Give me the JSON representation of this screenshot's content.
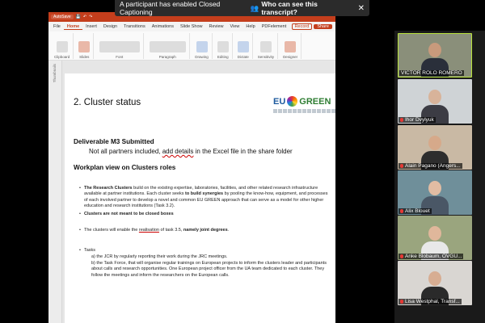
{
  "banner": {
    "message": "A participant has enabled Closed Captioning",
    "who_label": "Who can see this transcript?"
  },
  "ppt": {
    "autosave": "AutoSave",
    "tabs": [
      "File",
      "Home",
      "Insert",
      "Design",
      "Transitions",
      "Animations",
      "Slide Show",
      "Review",
      "View",
      "Help",
      "PDFelement"
    ],
    "active_tab": "Home",
    "record_label": "Record",
    "share_label": "Share",
    "ribbon_groups": [
      "Clipboard",
      "Slides",
      "Font",
      "Paragraph",
      "Drawing",
      "Editing",
      "Dictate",
      "Sensitivity",
      "Designer"
    ],
    "thumbnails_label": "Thumbnails"
  },
  "slide": {
    "title": "2. Cluster status",
    "logo_eu": "EU",
    "logo_green": "GREEN",
    "deliverable": "Deliverable M3 Submitted",
    "note_prefix": "Not all partners included, ",
    "note_underlined": "add details",
    "note_suffix": " in the Excel file in the share folder",
    "workplan": "Workplan view on Clusters roles",
    "b1_bold": "The Research Clusters",
    "b1_text": " build on the existing expertise, laboratories, facilities, and other related research infrastructure available at partner institutions. Each cluster seeks ",
    "b1_bold2": "to build synergies",
    "b1_text2": " by pooling the know-how, equipment, and processes of each involved partner to develop a novel and common EU GREEN approach that can serve as a model for other higher education and research institutions (Task 3.2).",
    "b2": "Clusters are not meant to be closed boxes",
    "b3_pre": "The clusters will enable the ",
    "b3_u": "realisation",
    "b3_mid": " of task 3.5, ",
    "b3_bold": "namely joint degrees",
    "b3_end": ".",
    "b4": "Tasks",
    "s1": "a) the JCR by regularly reporting their work during the JRC meetings.",
    "s2_pre": "b) the Task Force, that will ",
    "s2_u": "organise",
    "s2_text": " regular trainings on European projects to inform the clusters leader and participants about calls and research opportunities. One European project officer from the UA team dedicated to each cluster. They follow the meetings and inform the researchers on the European calls."
  },
  "participants": [
    {
      "name": "VICTOR ROLO ROMERO",
      "muted": false,
      "bg": "#8a8f7a",
      "skin": "#c89a7c",
      "shirt": "#2a2f3a"
    },
    {
      "name": "Ihor Dvylyuk",
      "muted": true,
      "bg": "#cfd3d6",
      "skin": "#d8b39a",
      "shirt": "#3c3c44"
    },
    {
      "name": "Alain Pagano (Angers...",
      "muted": true,
      "bg": "#c9b9a4",
      "skin": "#d6a98a",
      "shirt": "#2d2d2d"
    },
    {
      "name": "Alix Blouet",
      "muted": true,
      "bg": "#6f8f9a",
      "skin": "#e1bca3",
      "shirt": "#4a5766"
    },
    {
      "name": "Anke Blobaum, OVGU...",
      "muted": true,
      "bg": "#9aa57e",
      "skin": "#e0b79b",
      "shirt": "#e8e8e8"
    },
    {
      "name": "Lisa Westphal, Transf...",
      "muted": true,
      "bg": "#d9d6d2",
      "skin": "#d7ad92",
      "shirt": "#2a2a2a"
    }
  ]
}
